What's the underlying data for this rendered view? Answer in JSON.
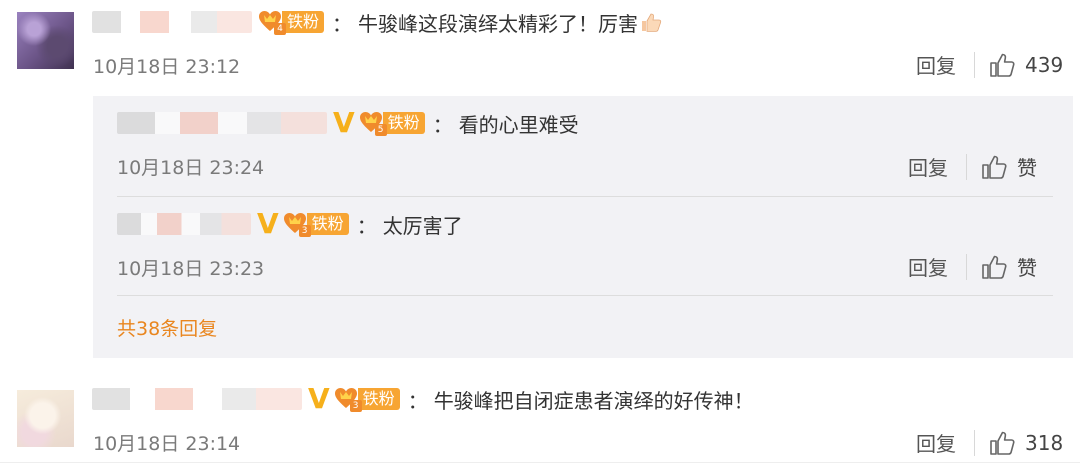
{
  "colors": {
    "fan_badge": "#f7a533",
    "vip_v": "#f6b01b",
    "more_link": "#e9861f",
    "reply_bg": "#f2f2f5"
  },
  "comments": [
    {
      "fan_level": "4",
      "fan_label": "铁粉",
      "colon": "：",
      "text": "牛骏峰这段演绎太精彩了！厉害",
      "emoji": "thumbs-up-emoji",
      "date": "10月18日 23:12",
      "reply_label": "回复",
      "likes": "439"
    },
    {
      "fan_level": "3",
      "fan_label": "铁粉",
      "vip": "V",
      "colon": "：",
      "text": "牛骏峰把自闭症患者演绎的好传神！",
      "date": "10月18日 23:14",
      "reply_label": "回复",
      "likes": "318"
    }
  ],
  "replies": [
    {
      "fan_level": "5",
      "fan_label": "铁粉",
      "vip": "V",
      "colon": "：",
      "text": "看的心里难受",
      "date": "10月18日 23:24",
      "reply_label": "回复",
      "like_label": "赞"
    },
    {
      "fan_level": "3",
      "fan_label": "铁粉",
      "vip": "V",
      "colon": "：",
      "text": "太厉害了",
      "date": "10月18日 23:23",
      "reply_label": "回复",
      "like_label": "赞"
    }
  ],
  "more_replies": "共38条回复",
  "icons": {
    "like": "thumbs-up-icon",
    "fan": "heart-badge-icon"
  }
}
